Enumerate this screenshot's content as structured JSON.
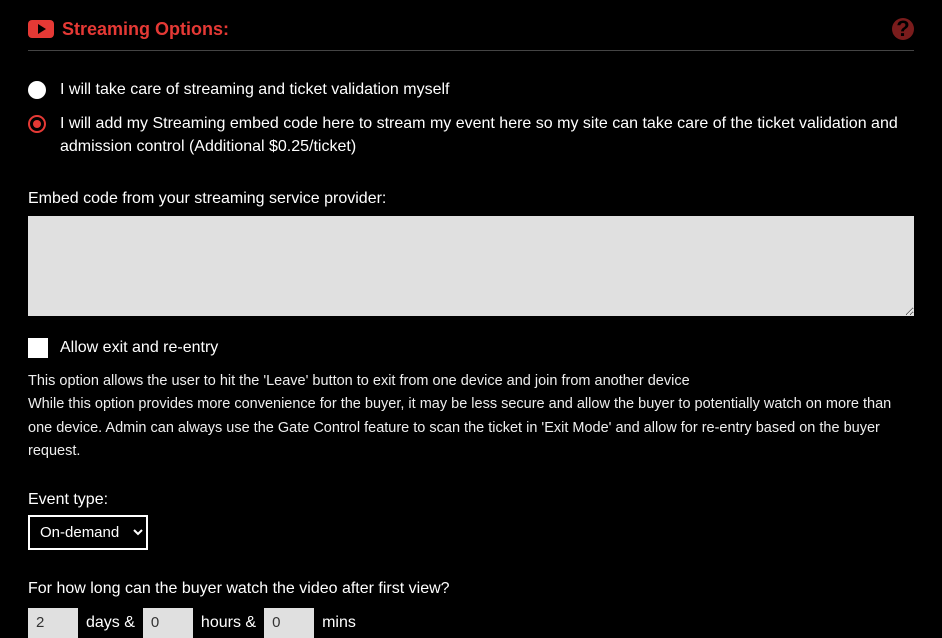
{
  "header": {
    "title": "Streaming Options:"
  },
  "radios": {
    "option1": "I will take care of streaming and ticket validation myself",
    "option2": "I will add my Streaming embed code here to stream my event here so my site can take care of the ticket validation and admission control (Additional $0.25/ticket)"
  },
  "embed": {
    "label": "Embed code from your streaming service provider:",
    "value": ""
  },
  "allowExit": {
    "label": "Allow exit and re-entry",
    "help1": "This option allows the user to hit the 'Leave' button to exit from one device and join from another device",
    "help2": "While this option provides more convenience for the buyer, it may be less secure and allow the buyer to potentially watch on more than one device. Admin can always use the Gate Control feature to scan the ticket in 'Exit Mode' and allow for re-entry based on the buyer request."
  },
  "eventType": {
    "label": "Event type:",
    "selected": "On-demand"
  },
  "duration": {
    "label": "For how long can the buyer watch the video after first view?",
    "days": "2",
    "daysLabel": "days &",
    "hours": "0",
    "hoursLabel": "hours &",
    "mins": "0",
    "minsLabel": "mins"
  }
}
